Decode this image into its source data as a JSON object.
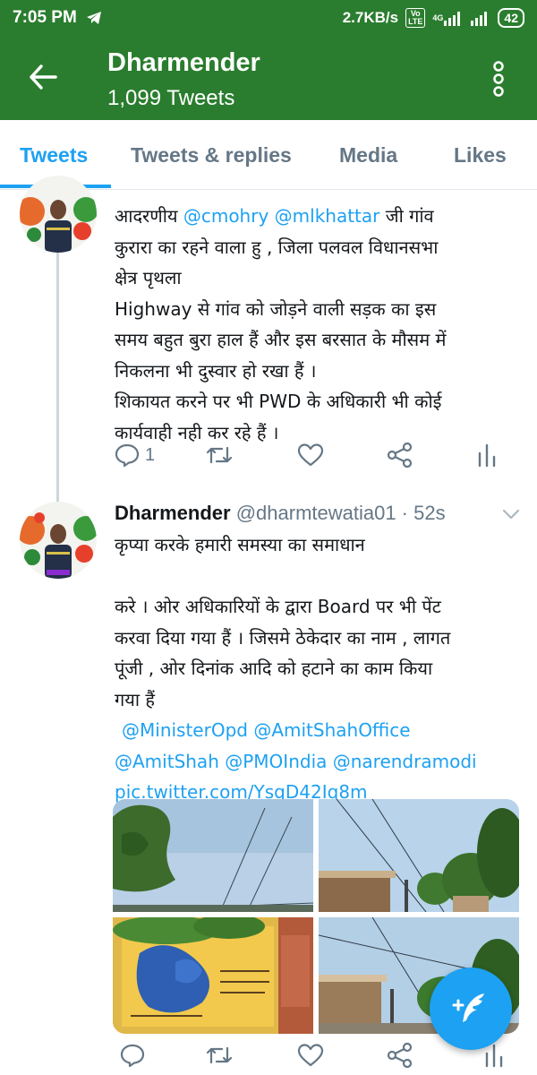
{
  "status_bar": {
    "time": "7:05 PM",
    "speed": "2.7KB/s",
    "volte_top": "Vo",
    "volte_bottom": "LTE",
    "network": "4G",
    "battery": "42",
    "icons": [
      "telegram-icon",
      "volte-icon",
      "signal-icon",
      "signal-icon",
      "battery-icon"
    ]
  },
  "header": {
    "title": "Dharmender",
    "subtitle": "1,099 Tweets",
    "bg_color": "#2a7d2e"
  },
  "tabs": [
    {
      "label": "Tweets",
      "active": true
    },
    {
      "label": "Tweets & replies",
      "active": false
    },
    {
      "label": "Media",
      "active": false
    },
    {
      "label": "Likes",
      "active": false
    }
  ],
  "tweet1": {
    "text_parts": {
      "l1_a": "आदरणीय ",
      "l1_m1": "@cmohry",
      "l1_b": " ",
      "l1_m2": "@mlkhattar",
      "l1_c": " जी गांव",
      "l2": "कुरारा का रहने वाला हु , जिला पलवल विधानसभा",
      "l3": "क्षेत्र पृथला",
      "l4": "Highway से गांव को जोड़ने वाली सड़क का इस",
      "l5": "समय बहुत बुरा हाल हैं और इस बरसात के मौसम में",
      "l6": "निकलना भी दुस्वार हो रखा हैं ।",
      "l7": "शिकायत करने पर भी PWD के अधिकारी भी कोई",
      "l8": "कार्यवाही नही कर रहे हैं ।"
    },
    "reply_count": "1"
  },
  "tweet2": {
    "name": "Dharmender",
    "handle": " @dharmtewatia01 · 52s",
    "text_parts": {
      "l1": "कृप्या करके हमारी समस्या का समाधान",
      "l2": "करे । ओर अधिकारियों के द्वारा Board पर भी पेंट",
      "l3": "करवा दिया गया हैं ।  जिसमे ठेकेदार का नाम , लागत",
      "l4": "पूंजी , ओर दिनांक आदि को हटाने का काम किया",
      "l5": "गया हैं",
      "l6_m1": "@MinisterOpd",
      "l6_m2": "@AmitShahOffice",
      "l7_m1": "@AmitShah",
      "l7_m2": "@PMOIndia",
      "l7_m3": "@narendramodi",
      "l8_link": "pic.twitter.com/YsgD42Iq8m"
    }
  },
  "colors": {
    "accent": "#1da1f2",
    "muted": "#657786",
    "text": "#14171a"
  }
}
